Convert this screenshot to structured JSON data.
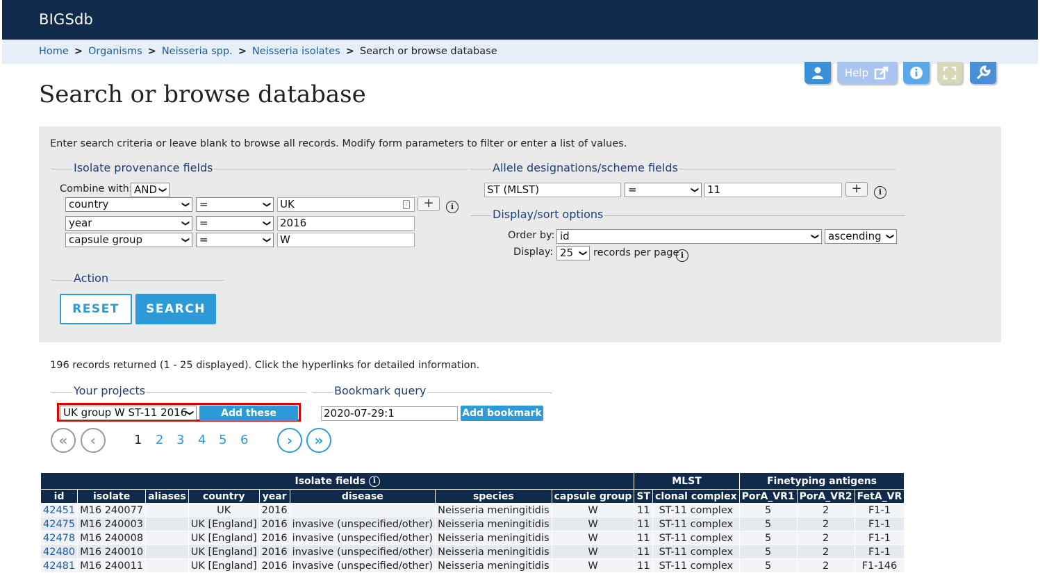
{
  "app": {
    "brand": "BIGSdb"
  },
  "breadcrumbs": {
    "items": [
      "Home",
      "Organisms",
      "Neisseria spp.",
      "Neisseria isolates"
    ],
    "separator": ">",
    "current": "Search or browse database"
  },
  "toolbar": {
    "help_label": "Help",
    "colors": {
      "user": "#3b8fd6",
      "help": "#a9c4f0",
      "info": "#5aa8e8",
      "expand": "#d8d8b8",
      "tools": "#4a8fd6"
    }
  },
  "page": {
    "title": "Search or browse database"
  },
  "form": {
    "intro": "Enter search criteria or leave blank to browse all records. Modify form parameters to filter or enter a list of values.",
    "provenance": {
      "legend": "Isolate provenance fields",
      "combine_label": "Combine with:",
      "combine_value": "AND",
      "rows": [
        {
          "field": "country",
          "operator": "=",
          "value": "UK"
        },
        {
          "field": "year",
          "operator": "=",
          "value": "2016"
        },
        {
          "field": "capsule group",
          "operator": "=",
          "value": "W"
        }
      ],
      "add_label": "+"
    },
    "allele": {
      "legend": "Allele designations/scheme fields",
      "field": "ST (MLST)",
      "operator": "=",
      "value": "11",
      "add_label": "+"
    },
    "display": {
      "legend": "Display/sort options",
      "order_label": "Order by:",
      "order_value": "id",
      "direction": "ascending",
      "display_label": "Display:",
      "per_page": "25",
      "per_page_suffix": "records per page"
    },
    "action": {
      "legend": "Action",
      "reset": "RESET",
      "search": "SEARCH"
    }
  },
  "results": {
    "summary": "196 records returned (1 - 25 displayed). Click the hyperlinks for detailed information.",
    "projects": {
      "legend": "Your projects",
      "selected": "UK group W ST-11 2016",
      "add_button": "Add these records"
    },
    "bookmark": {
      "legend": "Bookmark query",
      "value": "2020-07-29:1",
      "add_button": "Add bookmark"
    },
    "pager": {
      "pages": [
        "1",
        "2",
        "3",
        "4",
        "5",
        "6"
      ],
      "current": "1",
      "first": "«",
      "prev": "‹",
      "next": "›",
      "last": "»"
    },
    "table": {
      "groups": [
        "Isolate fields",
        "MLST",
        "Finetyping antigens"
      ],
      "columns": [
        "id",
        "isolate",
        "aliases",
        "country",
        "year",
        "disease",
        "species",
        "capsule group",
        "ST",
        "clonal complex",
        "PorA_VR1",
        "PorA_VR2",
        "FetA_VR"
      ],
      "rows": [
        [
          "42451",
          "M16 240077",
          "",
          "UK",
          "2016",
          "",
          "Neisseria meningitidis",
          "W",
          "11",
          "ST-11 complex",
          "5",
          "2",
          "F1-1"
        ],
        [
          "42475",
          "M16 240003",
          "",
          "UK [England]",
          "2016",
          "invasive (unspecified/other)",
          "Neisseria meningitidis",
          "W",
          "11",
          "ST-11 complex",
          "5",
          "2",
          "F1-1"
        ],
        [
          "42478",
          "M16 240008",
          "",
          "UK [England]",
          "2016",
          "invasive (unspecified/other)",
          "Neisseria meningitidis",
          "W",
          "11",
          "ST-11 complex",
          "5",
          "2",
          "F1-1"
        ],
        [
          "42480",
          "M16 240010",
          "",
          "UK [England]",
          "2016",
          "invasive (unspecified/other)",
          "Neisseria meningitidis",
          "W",
          "11",
          "ST-11 complex",
          "5",
          "2",
          "F1-1"
        ],
        [
          "42481",
          "M16 240011",
          "",
          "UK [England]",
          "2016",
          "invasive (unspecified/other)",
          "Neisseria meningitidis",
          "W",
          "11",
          "ST-11 complex",
          "5",
          "2",
          "F1-146"
        ]
      ]
    }
  }
}
